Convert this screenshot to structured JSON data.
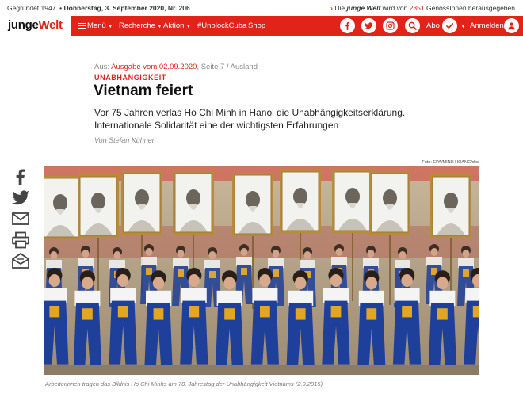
{
  "topbar": {
    "founded": "Gegründet 1947",
    "date": "Donnerstag, 3. September 2020, Nr. 206",
    "coop_prefix": "Die",
    "coop_brand": "junge Welt",
    "coop_mid": "wird von",
    "coop_count": "2351",
    "coop_suffix": "GenossInnen herausgegeben"
  },
  "logo": {
    "part1": "junge",
    "part2": "Welt"
  },
  "nav": {
    "menu": "Menü",
    "recherche": "Recherche",
    "aktion": "Aktion",
    "unblock": "#UnblockCuba",
    "shop": "Shop",
    "abo": "Abo",
    "login": "Anmelden"
  },
  "icons": {
    "facebook": "facebook-icon",
    "twitter": "twitter-icon",
    "instagram": "instagram-icon",
    "search": "search-icon",
    "check": "check-icon",
    "user": "user-icon",
    "mail": "mail-icon",
    "print": "print-icon",
    "newsletter": "newsletter-icon"
  },
  "article": {
    "source_prefix": "Aus:",
    "source_link": "Ausgabe vom 02.09.2020",
    "source_suffix": ", Seite 7 / Ausland",
    "kicker": "UNABHÄNGIGKEIT",
    "headline": "Vietnam feiert",
    "lead": "Vor 75 Jahren verlas Ho Chi Minh in Hanoi die Unabhängigkeitserklärung. Internationale Solidarität eine der wichtigsten Erfahrungen",
    "author": "Von Stefan Kühner"
  },
  "photo": {
    "credit": "Foto: EPA/MINH HOANG/dpa",
    "caption": "Arbeiterinnen tragen das Bildnis Ho Chi Minhs am 70. Jahrestag der Unabhängigkeit Vietnams (2.9.2015)"
  },
  "colors": {
    "brand_red": "#e2231a",
    "marcher_blue": "#1e3f9a"
  }
}
